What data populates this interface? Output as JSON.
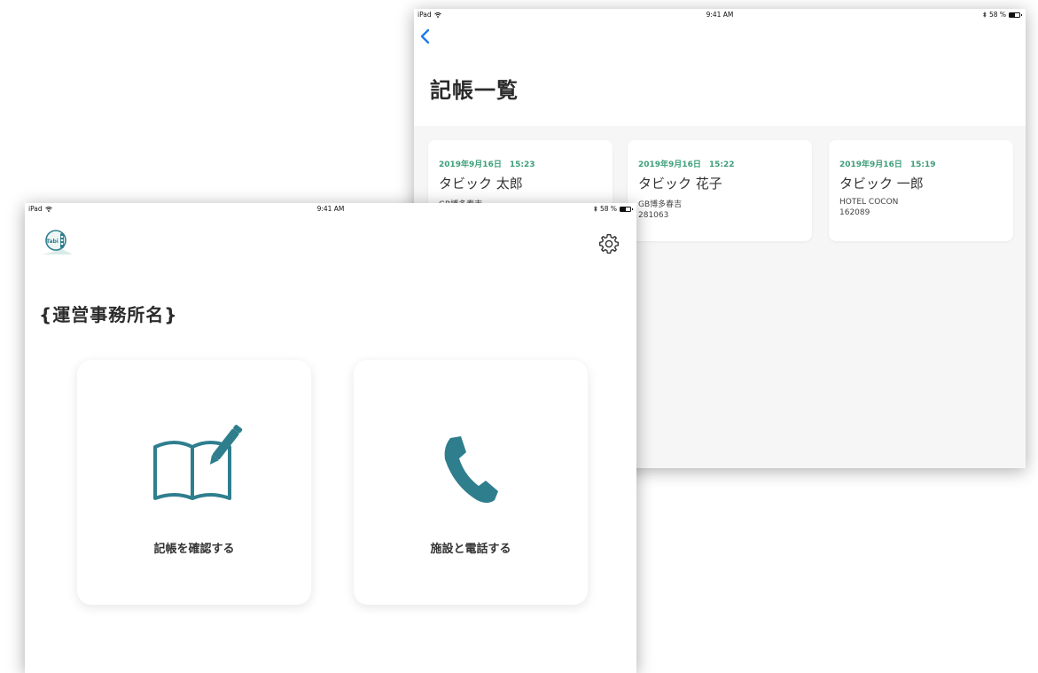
{
  "status_bar": {
    "device": "iPad",
    "time": "9:41 AM",
    "battery": "58 %",
    "battery_level": 0.58
  },
  "list_screen": {
    "title": "記帳一覧",
    "entries": [
      {
        "date": "2019年9月16日　15:23",
        "name": "タビック 太郎",
        "hotel": "GB博多春吉",
        "code": ""
      },
      {
        "date": "2019年9月16日　15:22",
        "name": "タビック 花子",
        "hotel": "GB博多春吉",
        "code": "281063"
      },
      {
        "date": "2019年9月16日　15:19",
        "name": "タビック 一郎",
        "hotel": "HOTEL COCON",
        "code": "162089"
      }
    ]
  },
  "home_screen": {
    "logo_text": "Tabi",
    "office_name": "{運営事務所名}",
    "actions": [
      {
        "label": "記帳を確認する",
        "icon": "book-pen-icon"
      },
      {
        "label": "施設と電話する",
        "icon": "phone-icon"
      }
    ]
  },
  "colors": {
    "accent": "#2f7e8e",
    "date_green": "#3d9e7a",
    "back_blue": "#1a7cf0"
  }
}
